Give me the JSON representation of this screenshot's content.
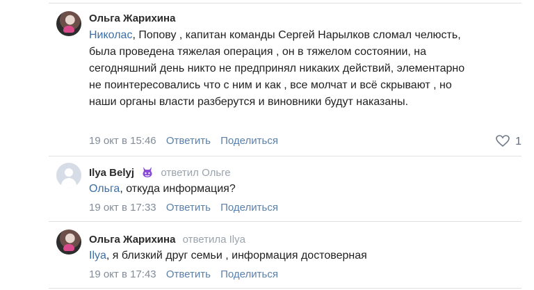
{
  "comments": [
    {
      "author": "Ольга Жарихина",
      "mention": "Николас",
      "text": ", Попову , капитан команды Сергей Нарылков сломал челюсть, была проведена тяжелая операция , он в тяжелом состоянии, на сегодняшний день никто не предпринял никаких действий, элементарно не поинтересовались что с ним и как , все молчат и всё скрывают , но наши органы власти разберутся и виновники будут наказаны.",
      "time": "19 окт в 15:46",
      "reply": "Ответить",
      "share": "Поделиться",
      "likes": "1"
    },
    {
      "author": "Ilya Belyj",
      "reply_note": "ответил Ольге",
      "mention": "Ольга",
      "text": ", откуда информация?",
      "time": "19 окт в 17:33",
      "reply": "Ответить",
      "share": "Поделиться"
    },
    {
      "author": "Ольга Жарихина",
      "reply_note": "ответила Ilya",
      "mention": "Ilya",
      "text": ", я близкий друг семьи , информация достоверная",
      "time": "19 окт в 17:43",
      "reply": "Ответить",
      "share": "Поделиться"
    }
  ],
  "icons": {
    "heart": "heart-icon",
    "devil": "devil-emoji-icon"
  },
  "colors": {
    "link": "#3d6fa6",
    "meta": "#818c99",
    "divider": "#dfe1e5",
    "emoji": "#8a4bd6"
  }
}
